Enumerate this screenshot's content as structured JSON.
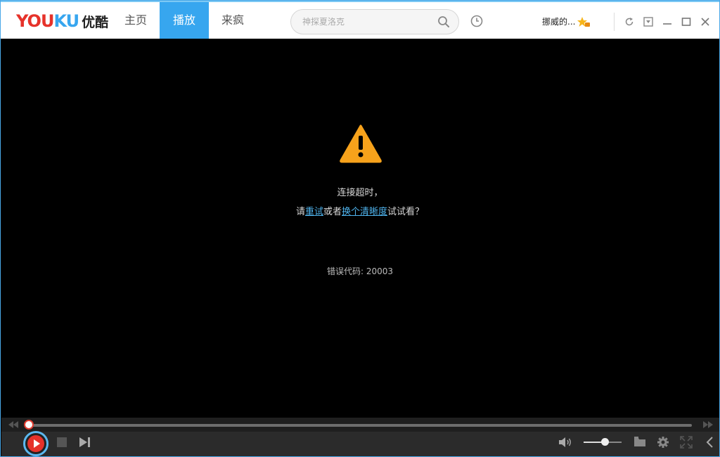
{
  "app": {
    "logo_text": "YOUKU",
    "logo_cn": "优酷",
    "brand_colors": {
      "primary_red": "#e6322a",
      "accent_blue": "#37a6ef",
      "warning_orange": "#f7a21b"
    }
  },
  "nav": {
    "tabs": [
      {
        "label": "主页",
        "active": false
      },
      {
        "label": "播放",
        "active": true
      },
      {
        "label": "来疯",
        "active": false
      }
    ]
  },
  "search": {
    "placeholder": "神探夏洛克",
    "value": ""
  },
  "user": {
    "name": "挪威的..."
  },
  "icons": {
    "search": "search-icon",
    "history": "clock-icon",
    "badge": "vip-star-badge-icon",
    "refresh": "refresh-icon",
    "mini_mode": "mini-mode-icon",
    "minimize": "minimize-icon",
    "maximize": "maximize-icon",
    "close": "close-icon",
    "warning": "warning-triangle-icon",
    "play": "play-icon",
    "stop": "stop-icon",
    "next": "next-track-icon",
    "rewind": "rewind-icon",
    "forward": "fast-forward-icon",
    "volume": "volume-icon",
    "folder": "folder-icon",
    "settings": "gear-icon",
    "fullscreen": "fullscreen-icon",
    "collapse": "chevron-left-icon"
  },
  "error": {
    "line1": "连接超时，",
    "line2_prefix": "请",
    "retry_link": "重试",
    "line2_mid": "或者",
    "change_quality_link": "换个清晰度",
    "line2_suffix": "试试看？",
    "code_label": "错误代码:",
    "code_value": "20003"
  },
  "player": {
    "progress": 0,
    "volume": 0.55
  }
}
